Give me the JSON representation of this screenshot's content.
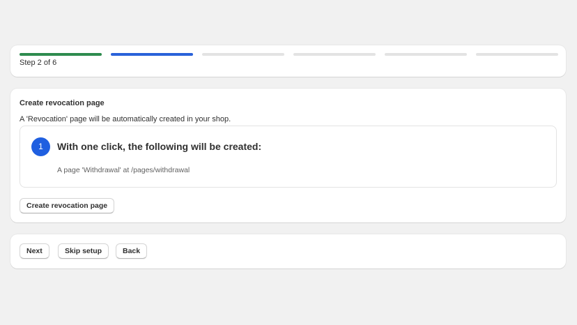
{
  "progress": {
    "segments": [
      {
        "color": "#2e8b4e"
      },
      {
        "color": "#2a62d9"
      },
      {
        "color": "#e3e3e3"
      },
      {
        "color": "#e3e3e3"
      },
      {
        "color": "#e3e3e3"
      },
      {
        "color": "#e3e3e3"
      }
    ],
    "step_text": "Step 2 of 6"
  },
  "main": {
    "title": "Create revocation page",
    "description": "A 'Revocation' page will be automatically created in your shop.",
    "info": {
      "step_number": "1",
      "heading": "With one click, the following will be created:",
      "item": "A page 'Withdrawal' at /pages/withdrawal"
    },
    "create_button": "Create revocation page"
  },
  "nav": {
    "next": "Next",
    "skip": "Skip setup",
    "back": "Back"
  }
}
